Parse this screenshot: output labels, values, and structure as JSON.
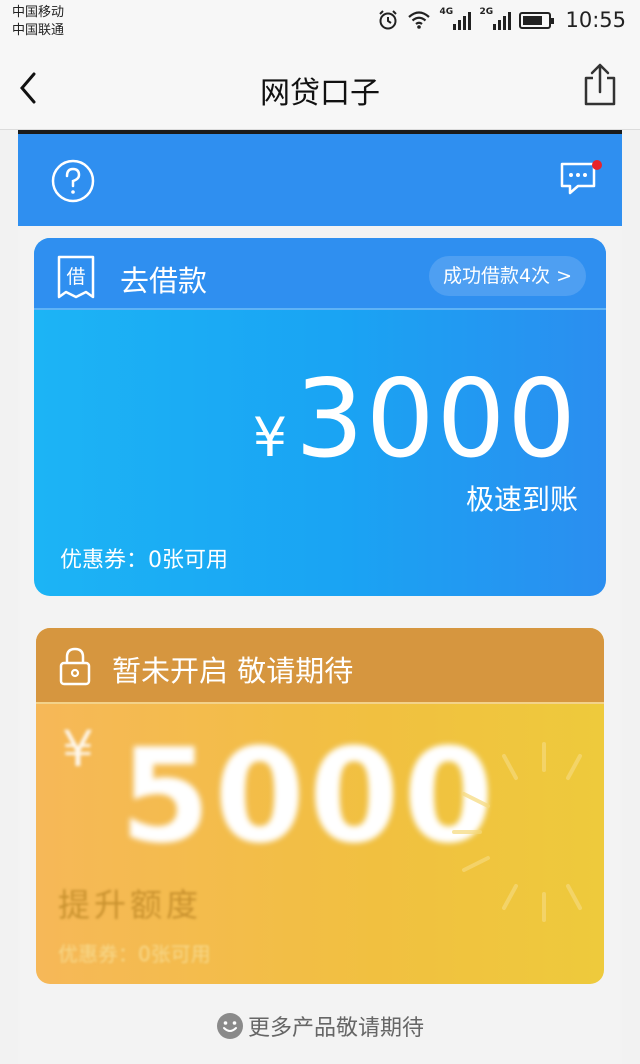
{
  "status_bar": {
    "carrier_1": "中国移动",
    "carrier_2": "中国联通",
    "signal_1_tag": "4G",
    "signal_2_tag": "2G",
    "battery_level": 0.8,
    "time": "10:55"
  },
  "nav": {
    "title": "网贷口子"
  },
  "loan_card": {
    "title": "去借款",
    "head_icon_char": "借",
    "success_badge": "成功借款4次 >",
    "currency": "¥",
    "amount": "3000",
    "subtitle": "极速到账",
    "coupon": "优惠券：0张可用"
  },
  "locked_card": {
    "title": "暂未开启 敬请期待",
    "currency": "¥",
    "amount": "5000",
    "subtitle": "提升额度",
    "coupon": "优惠券：0张可用"
  },
  "footer": {
    "more_text": "更多产品敬请期待"
  },
  "colors": {
    "header_blue": "#2f8ff0",
    "loan_gradient_start": "#1cb4f5",
    "lock_head": "#d6963f",
    "lock_gradient": "#f1c040",
    "notification_dot": "#e8232b"
  },
  "icons": [
    "alarm-icon",
    "wifi-icon",
    "back-arrow-icon",
    "share-icon",
    "help-icon",
    "message-icon",
    "loan-receipt-icon",
    "lock-icon",
    "smile-icon"
  ]
}
